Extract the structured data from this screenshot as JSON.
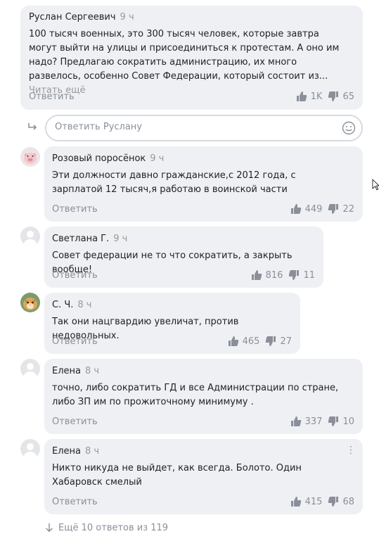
{
  "top_comment": {
    "author": "Руслан Сергеевич",
    "time": "9 ч",
    "text": "100 тысяч военных, это  300 тысяч человек, которые завтра могут выйти на улицы и присоединиться к  протестам. А оно им надо? Предлагаю сократить администрацию, их много развелось, особенно Совет Федерации, который состоит из...",
    "read_more": "Читать ещё",
    "reply_label": "Ответить",
    "likes": "1K",
    "dislikes": "65"
  },
  "reply_box": {
    "placeholder": "Ответить Руслану",
    "emoji_icon": "smile-icon",
    "reply_arrow_icon": "reply-arrow-icon"
  },
  "replies": [
    {
      "author": "Розовый поросёнок",
      "time": "9 ч",
      "text": "Эти должности давно гражданские,с 2012 года, с зарплатой 12 тысяч,я работаю в воинской части",
      "reply_label": "Ответить",
      "likes": "449",
      "dislikes": "22",
      "avatar": "pig-avatar"
    },
    {
      "author": "Светлана Г.",
      "time": "9 ч",
      "text": "Совет федерации не то что сократить, а закрыть вообще!",
      "reply_label": "Ответить",
      "likes": "816",
      "dislikes": "11",
      "avatar": "default-avatar"
    },
    {
      "author": "С. Ч.",
      "time": "8 ч",
      "text": "Так они нацгвардию увеличат, против недовольных.",
      "reply_label": "Ответить",
      "likes": "465",
      "dislikes": "27",
      "avatar": "cat-avatar"
    },
    {
      "author": "Елена",
      "time": "8 ч",
      "text": "точно, либо сократить ГД и все Администрации по стране, либо ЗП им по прожиточному минимуму .",
      "reply_label": "Ответить",
      "likes": "337",
      "dislikes": "10",
      "avatar": "default-avatar"
    },
    {
      "author": "Елена",
      "time": "8 ч",
      "text": "Никто никуда не выйдет, как всегда. Болото. Один Хабаровск смелый",
      "reply_label": "Ответить",
      "likes": "415",
      "dislikes": "68",
      "avatar": "default-avatar",
      "more_menu": "⋮"
    }
  ],
  "more_replies": {
    "label": "Ещё 10 ответов из 119",
    "icon": "arrow-down-icon"
  },
  "colors": {
    "bubble": "#eef0f3",
    "muted": "#8a8f99",
    "text": "#222222"
  }
}
